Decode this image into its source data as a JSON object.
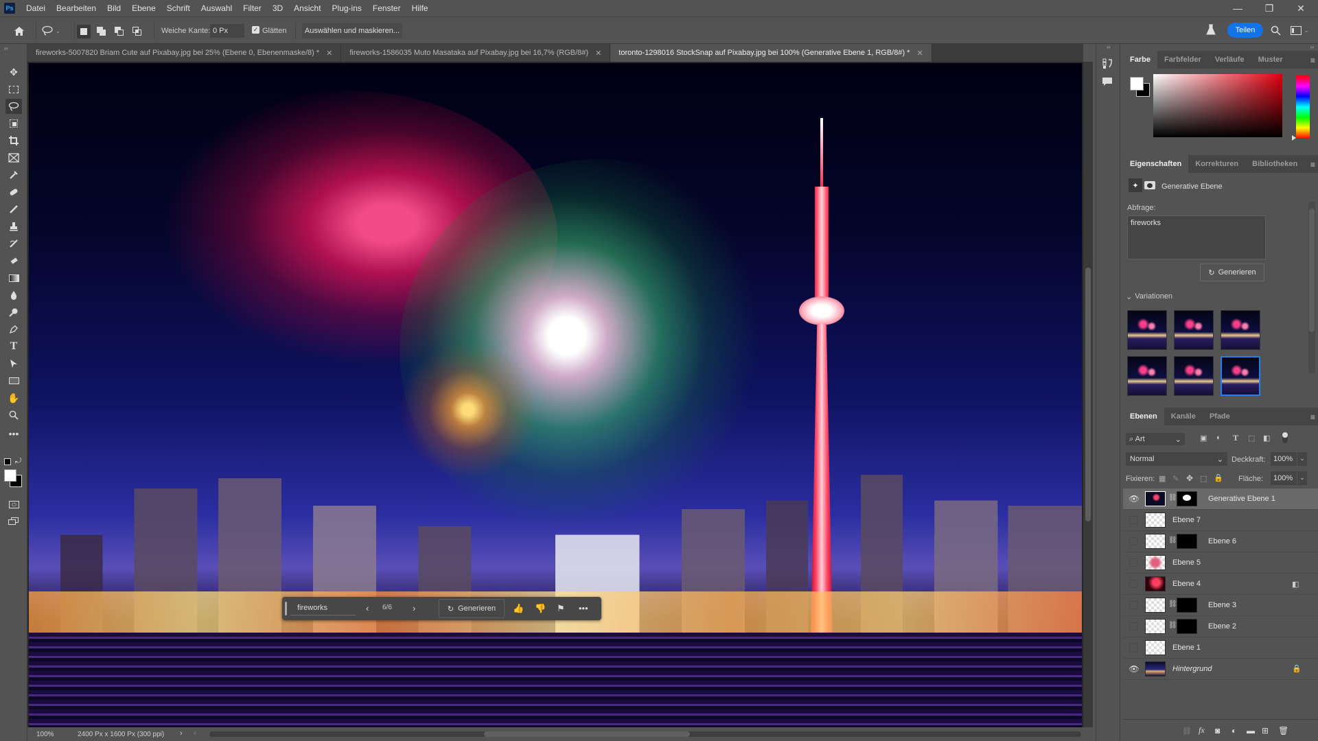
{
  "app": {
    "logo": "Ps"
  },
  "menu": [
    "Datei",
    "Bearbeiten",
    "Bild",
    "Ebene",
    "Schrift",
    "Auswahl",
    "Filter",
    "3D",
    "Ansicht",
    "Plug-ins",
    "Fenster",
    "Hilfe"
  ],
  "window_controls": {
    "minimize": "—",
    "restore": "❐",
    "close": "✕"
  },
  "options": {
    "feather_label": "Weiche Kante:",
    "feather_value": "0 Px",
    "smooth_checked": true,
    "smooth_label": "Glätten",
    "select_mask_label": "Auswählen und maskieren...",
    "share_label": "Teilen"
  },
  "tabs": [
    {
      "title": "fireworks-5007820 Briam Cute auf Pixabay.jpg bei 25% (Ebene 0, Ebenenmaske/8) *",
      "active": false
    },
    {
      "title": "fireworks-1586035 Muto Masataka auf Pixabay.jpg bei 16,7% (RGB/8#)",
      "active": false
    },
    {
      "title": "toronto-1298016 StockSnap auf Pixabay.jpg bei 100% (Generative Ebene 1, RGB/8#) *",
      "active": true
    }
  ],
  "tools": [
    "move",
    "marquee",
    "lasso",
    "object-select",
    "crop",
    "frame",
    "eyedropper",
    "healing-brush",
    "brush",
    "clone-stamp",
    "history-brush",
    "eraser",
    "gradient",
    "blur",
    "dodge",
    "pen",
    "type",
    "path-select",
    "rectangle",
    "hand",
    "zoom",
    "more"
  ],
  "taskbar": {
    "prompt": "fireworks",
    "counter": "6/6",
    "generate_label": "Generieren"
  },
  "status": {
    "zoom": "100%",
    "doc_info": "2400 Px x 1600 Px (300 ppi)"
  },
  "color_panel": {
    "tabs": [
      "Farbe",
      "Farbfelder",
      "Verläufe",
      "Muster"
    ],
    "active_tab": "Farbe",
    "foreground": "#ffffff",
    "background": "#000000"
  },
  "properties_panel": {
    "tabs": [
      "Eigenschaften",
      "Korrekturen",
      "Bibliotheken"
    ],
    "active_tab": "Eigenschaften",
    "layer_type": "Generative Ebene",
    "prompt_label": "Abfrage:",
    "prompt_value": "fireworks",
    "generate_label": "Generieren",
    "variations_label": "Variationen",
    "variations_count": 6,
    "selected_variation": 6
  },
  "layers_panel": {
    "tabs": [
      "Ebenen",
      "Kanäle",
      "Pfade"
    ],
    "active_tab": "Ebenen",
    "filter_label": "Art",
    "blend_mode": "Normal",
    "opacity_label": "Deckkraft:",
    "opacity_value": "100%",
    "lock_label": "Fixieren:",
    "fill_label": "Fläche:",
    "fill_value": "100%",
    "layers": [
      {
        "name": "Generative Ebene 1",
        "visible": true,
        "selected": true,
        "has_mask": true
      },
      {
        "name": "Ebene 7",
        "visible": false,
        "selected": false,
        "has_mask": false
      },
      {
        "name": "Ebene 6",
        "visible": false,
        "selected": false,
        "has_mask": true
      },
      {
        "name": "Ebene 5",
        "visible": false,
        "selected": false,
        "has_mask": false
      },
      {
        "name": "Ebene 4",
        "visible": false,
        "selected": false,
        "has_mask": false
      },
      {
        "name": "Ebene 3",
        "visible": false,
        "selected": false,
        "has_mask": true
      },
      {
        "name": "Ebene 2",
        "visible": false,
        "selected": false,
        "has_mask": true
      },
      {
        "name": "Ebene 1",
        "visible": false,
        "selected": false,
        "has_mask": false
      },
      {
        "name": "Hintergrund",
        "visible": true,
        "selected": false,
        "has_mask": false,
        "locked": true
      }
    ]
  }
}
